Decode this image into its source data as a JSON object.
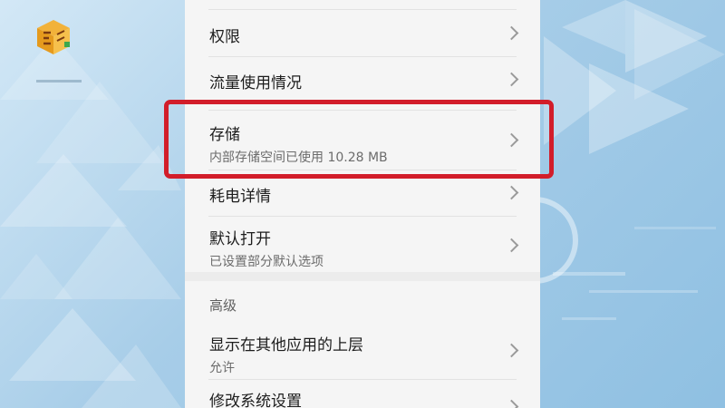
{
  "settings": {
    "items": [
      {
        "title": "权限",
        "subtitle": ""
      },
      {
        "title": "流量使用情况",
        "subtitle": ""
      },
      {
        "title": "存储",
        "subtitle": "内部存储空间已使用 10.28 MB"
      },
      {
        "title": "耗电详情",
        "subtitle": ""
      },
      {
        "title": "默认打开",
        "subtitle": "已设置部分默认选项"
      }
    ],
    "advanced": {
      "label": "高级",
      "items": [
        {
          "title": "显示在其他应用的上层",
          "subtitle": "允许"
        },
        {
          "title": "修改系统设置",
          "subtitle": ""
        }
      ]
    }
  },
  "colors": {
    "highlight": "#d21d2a",
    "panel": "#f5f5f5"
  },
  "icons": [
    "chevron-right-icon",
    "logo-cube-icon"
  ]
}
